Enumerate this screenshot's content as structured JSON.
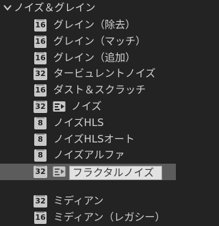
{
  "group": {
    "label": "ノイズ＆グレイン",
    "chevron_icon": "chevron-down-icon"
  },
  "items": [
    {
      "bpc": "16",
      "label": "グレイン（除去）",
      "preset": false,
      "selected": false
    },
    {
      "bpc": "16",
      "label": "グレイン（マッチ）",
      "preset": false,
      "selected": false
    },
    {
      "bpc": "16",
      "label": "グレイン（追加）",
      "preset": false,
      "selected": false
    },
    {
      "bpc": "32",
      "label": "タービュレントノイズ",
      "preset": false,
      "selected": false
    },
    {
      "bpc": "16",
      "label": "ダスト＆スクラッチ",
      "preset": false,
      "selected": false
    },
    {
      "bpc": "32",
      "label": "ノイズ",
      "preset": true,
      "preset_icon": "animation-preset-icon",
      "selected": false
    },
    {
      "bpc": "8",
      "label": "ノイズHLS",
      "preset": false,
      "selected": false
    },
    {
      "bpc": "8",
      "label": "ノイズHLSオート",
      "preset": false,
      "selected": false
    },
    {
      "bpc": "8",
      "label": "ノイズアルファ",
      "preset": false,
      "selected": false
    },
    {
      "bpc": "32",
      "label": "フラクタルノイズ",
      "preset": false,
      "selected": true
    },
    {
      "bpc": "32",
      "label": "ミディアン",
      "preset": false,
      "selected": false
    },
    {
      "bpc": "16",
      "label": "ミディアン（レガシー）",
      "preset": false,
      "selected": false
    }
  ],
  "colors": {
    "background": "#232323",
    "selected_row": "#5c5c5c",
    "badge": "#c8c8c8",
    "text": "#d2d2d2"
  }
}
